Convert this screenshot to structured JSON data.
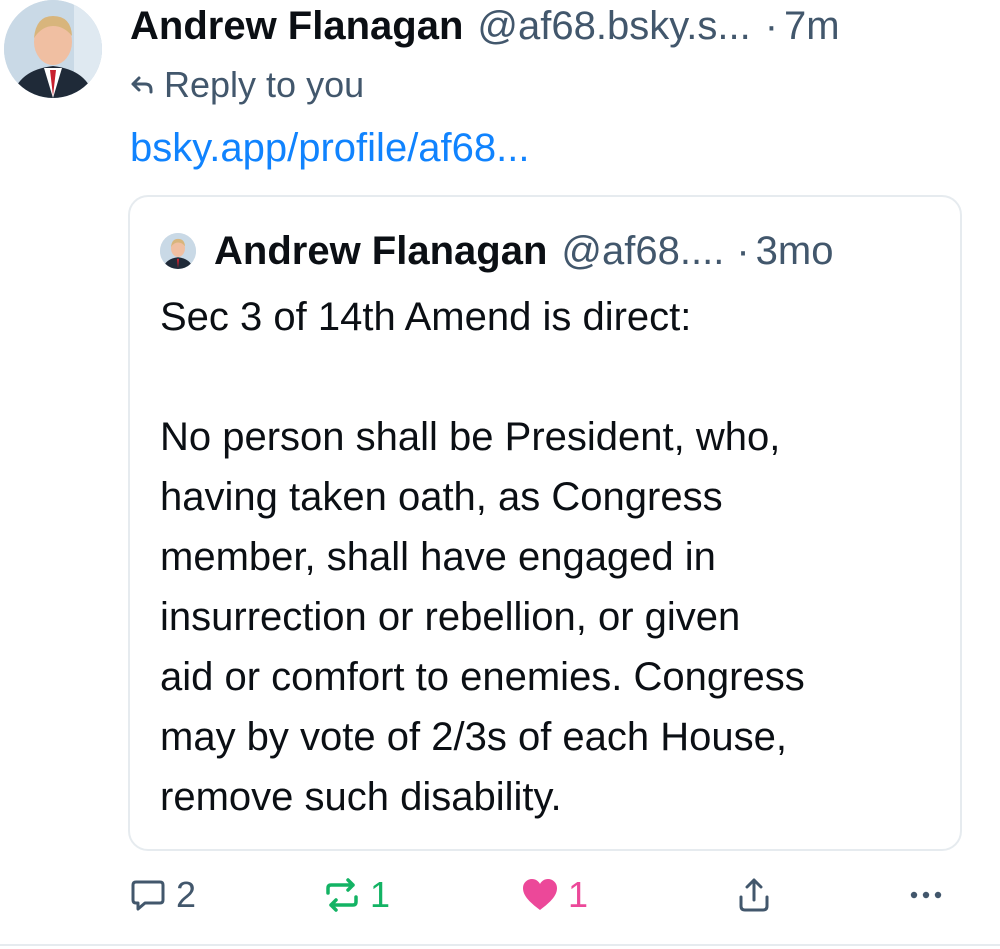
{
  "post": {
    "author_name": "Andrew Flanagan",
    "handle": "@af68.bsky.s...",
    "separator": "·",
    "time": "7m",
    "reply_text": "Reply to you",
    "link_text": "bsky.app/profile/af68...",
    "avatar_icon": "profile-photo"
  },
  "quote": {
    "author_name": "Andrew Flanagan",
    "handle": "@af68....",
    "separator": "·",
    "time": "3mo",
    "body": "Sec 3 of 14th Amend is direct:\n\nNo person shall be President, who,\nhaving taken oath, as Congress\nmember, shall have engaged in\ninsurrection or rebellion, or given\naid or comfort to enemies. Congress\nmay by vote of 2/3s of each House,\nremove such disability."
  },
  "actions": {
    "reply_count": "2",
    "repost_count": "1",
    "like_count": "1",
    "icons": [
      "reply-icon",
      "repost-icon",
      "heart-icon",
      "share-icon",
      "more-icon"
    ]
  },
  "colors": {
    "link": "#1083fe",
    "muted": "#42576c",
    "repost_active": "#13b364",
    "like_active": "#ec4899",
    "border": "#e6ebef"
  }
}
